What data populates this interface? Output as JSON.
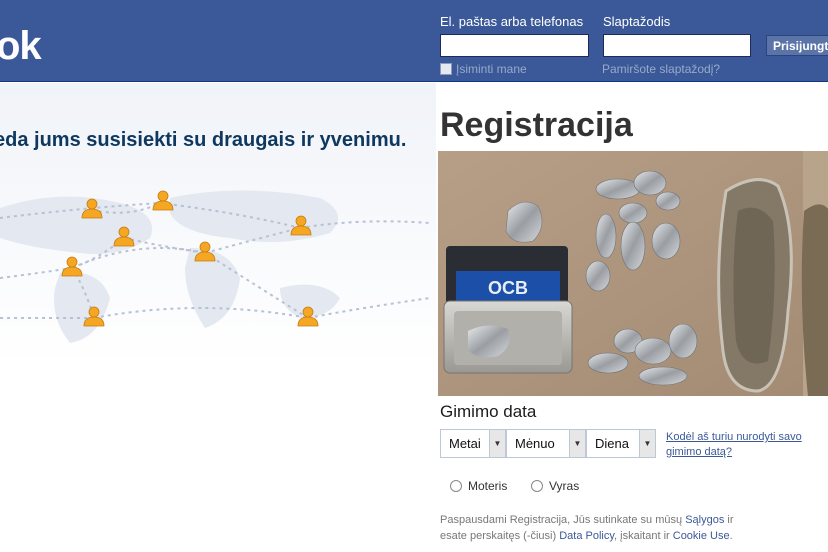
{
  "header": {
    "logo": "ok",
    "email_label": "El. paštas arba telefonas",
    "password_label": "Slaptažodis",
    "login_button": "Prisijungti",
    "remember_label": "Įsiminti mane",
    "forgot_link": "Pamiršote slaptažodį?"
  },
  "left": {
    "tagline": "eda jums susisiekti su draugais ir yvenimu."
  },
  "registration": {
    "title": "Registracija",
    "birthday_label": "Gimimo data",
    "year_select": "Metai",
    "month_select": "Mėnuo",
    "day_select": "Diena",
    "why_link": "Kodėl aš turiu nurodyti savo gimimo datą?",
    "female_label": "Moteris",
    "male_label": "Vyras",
    "terms_part1": "Paspausdami Registracija, Jūs sutinkate su mūsų",
    "terms_link1": "Sąlygos",
    "terms_part2": "ir esate perskaitęs (-čiusi)",
    "terms_link2": "Data Policy",
    "terms_part3": ", įskaitant ir",
    "terms_link3": "Cookie Use",
    "terms_end": "."
  },
  "colors": {
    "header_bg": "#3b5998",
    "tagline": "#0e385f",
    "person_icon": "#f5a623"
  }
}
